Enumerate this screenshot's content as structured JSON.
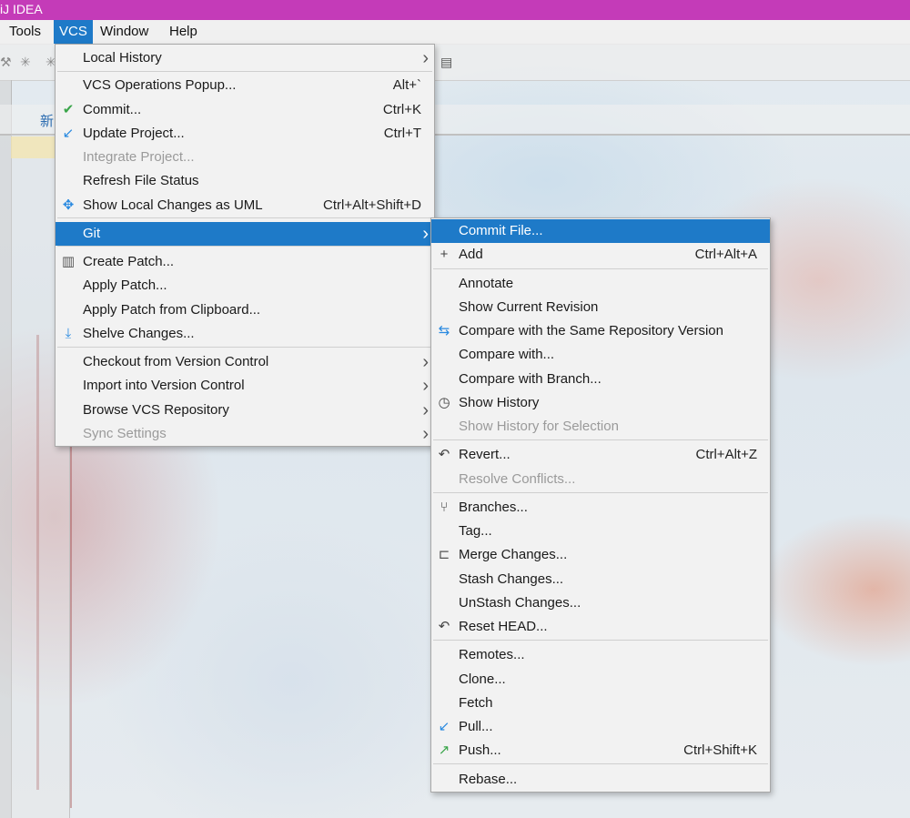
{
  "window": {
    "title": "iJ IDEA"
  },
  "menubar": {
    "items": [
      "Tools",
      "VCS",
      "Window",
      "Help"
    ]
  },
  "tab": {
    "label": "新"
  },
  "vcs_menu": {
    "items": [
      {
        "label": "Local History",
        "shortcut": "",
        "submenu": true
      },
      {
        "label": "VCS Operations Popup...",
        "shortcut": "Alt+`"
      },
      {
        "label": "Commit...",
        "shortcut": "Ctrl+K",
        "icon": "check-icon"
      },
      {
        "label": "Update Project...",
        "shortcut": "Ctrl+T",
        "icon": "update-arrow-icon"
      },
      {
        "label": "Integrate Project...",
        "shortcut": "",
        "disabled": true
      },
      {
        "label": "Refresh File Status",
        "shortcut": ""
      },
      {
        "label": "Show Local Changes as UML",
        "shortcut": "Ctrl+Alt+Shift+D",
        "icon": "uml-icon"
      },
      {
        "label": "Git",
        "shortcut": "",
        "submenu": true,
        "selected": true
      },
      {
        "label": "Create Patch...",
        "shortcut": "",
        "icon": "patch-icon"
      },
      {
        "label": "Apply Patch...",
        "shortcut": ""
      },
      {
        "label": "Apply Patch from Clipboard...",
        "shortcut": ""
      },
      {
        "label": "Shelve Changes...",
        "shortcut": "",
        "icon": "shelve-icon"
      },
      {
        "label": "Checkout from Version Control",
        "shortcut": "",
        "submenu": true
      },
      {
        "label": "Import into Version Control",
        "shortcut": "",
        "submenu": true
      },
      {
        "label": "Browse VCS Repository",
        "shortcut": "",
        "submenu": true
      },
      {
        "label": "Sync Settings",
        "shortcut": "",
        "submenu": true,
        "disabled": true
      }
    ]
  },
  "git_menu": {
    "items": [
      {
        "label": "Commit File...",
        "shortcut": "",
        "selected": true
      },
      {
        "label": "Add",
        "shortcut": "Ctrl+Alt+A",
        "icon": "plus-icon"
      },
      {
        "label": "Annotate",
        "shortcut": ""
      },
      {
        "label": "Show Current Revision",
        "shortcut": ""
      },
      {
        "label": "Compare with the Same Repository Version",
        "shortcut": "",
        "icon": "compare-icon"
      },
      {
        "label": "Compare with...",
        "shortcut": ""
      },
      {
        "label": "Compare with Branch...",
        "shortcut": ""
      },
      {
        "label": "Show History",
        "shortcut": "",
        "icon": "clock-icon"
      },
      {
        "label": "Show History for Selection",
        "shortcut": "",
        "disabled": true
      },
      {
        "label": "Revert...",
        "shortcut": "Ctrl+Alt+Z",
        "icon": "revert-icon"
      },
      {
        "label": "Resolve Conflicts...",
        "shortcut": "",
        "disabled": true
      },
      {
        "label": "Branches...",
        "shortcut": "",
        "icon": "branch-icon"
      },
      {
        "label": "Tag...",
        "shortcut": ""
      },
      {
        "label": "Merge Changes...",
        "shortcut": "",
        "icon": "merge-icon"
      },
      {
        "label": "Stash Changes...",
        "shortcut": ""
      },
      {
        "label": "UnStash Changes...",
        "shortcut": ""
      },
      {
        "label": "Reset HEAD...",
        "shortcut": "",
        "icon": "reset-icon"
      },
      {
        "label": "Remotes...",
        "shortcut": ""
      },
      {
        "label": "Clone...",
        "shortcut": ""
      },
      {
        "label": "Fetch",
        "shortcut": ""
      },
      {
        "label": "Pull...",
        "shortcut": "",
        "icon": "pull-icon"
      },
      {
        "label": "Push...",
        "shortcut": "Ctrl+Shift+K",
        "icon": "push-icon"
      },
      {
        "label": "Rebase...",
        "shortcut": ""
      }
    ]
  },
  "colors": {
    "title_bar": "#c43bb8",
    "selection": "#1e7ac8",
    "check_green": "#3aa54a",
    "arrow_blue": "#2a8ae0"
  }
}
